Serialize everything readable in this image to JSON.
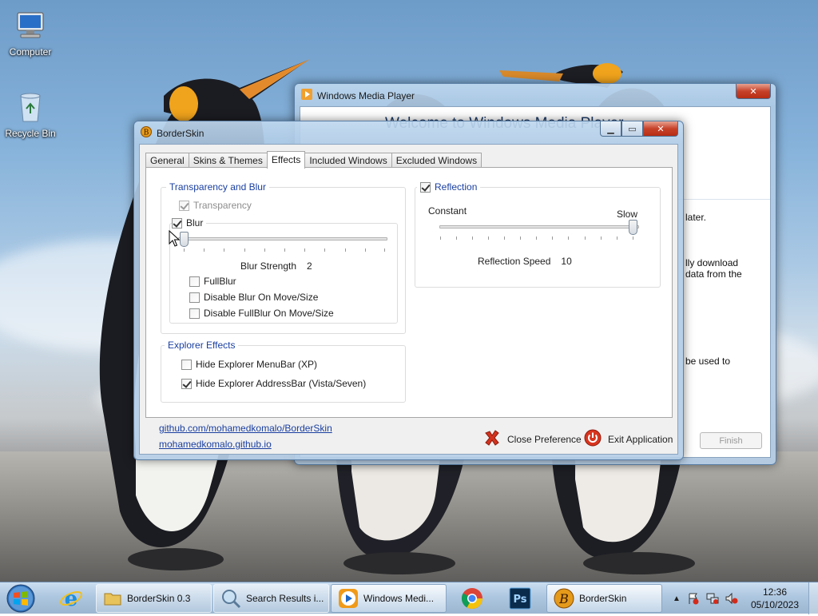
{
  "desktop": {
    "icons": [
      {
        "label": "Computer",
        "icon": "computer-icon"
      },
      {
        "label": "Recycle Bin",
        "icon": "recycle-bin-icon"
      }
    ]
  },
  "wmp": {
    "title": "Windows Media Player",
    "welcome": "Welcome to Windows Media Player",
    "fragment1": "later.",
    "fragment2a": "lly download",
    "fragment2b": "data from the",
    "fragment3": "be used to",
    "finish": "Finish"
  },
  "borderskin": {
    "title": "BorderSkin",
    "tabs": [
      "General",
      "Skins & Themes",
      "Effects",
      "Included Windows",
      "Excluded Windows"
    ],
    "active_tab": "Effects",
    "transparency_group": {
      "caption": "Transparency and Blur",
      "transparency": {
        "label": "Transparency",
        "checked": true,
        "enabled": false
      },
      "blur": {
        "label": "Blur",
        "checked": true
      },
      "blur_strength_label": "Blur Strength",
      "blur_strength_value": "2",
      "fullblur": {
        "label": "FullBlur",
        "checked": false
      },
      "disable_blur_move": {
        "label": "Disable Blur On Move/Size",
        "checked": false
      },
      "disable_fullblur_move": {
        "label": "Disable FullBlur On Move/Size",
        "checked": false
      }
    },
    "reflection_group": {
      "caption": "Reflection",
      "checked": true,
      "left_label": "Constant",
      "right_label": "Slow",
      "speed_label": "Reflection Speed",
      "speed_value": "10"
    },
    "explorer_group": {
      "caption": "Explorer Effects",
      "hide_menubar": {
        "label": "Hide Explorer MenuBar (XP)",
        "checked": false
      },
      "hide_addressbar": {
        "label": "Hide Explorer AddressBar (Vista/Seven)",
        "checked": true
      }
    },
    "links": [
      "github.com/mohamedkomalo/BorderSkin",
      "mohamedkomalo.github.io"
    ],
    "close_preference": "Close Preference",
    "exit_application": "Exit Application"
  },
  "taskbar": {
    "items": [
      {
        "label": "BorderSkin 0.3",
        "icon": "folder-icon"
      },
      {
        "label": "Search Results i...",
        "icon": "search-icon"
      },
      {
        "label": "Windows Medi...",
        "icon": "media-player-icon"
      },
      {
        "label": "BorderSkin",
        "icon": "borderskin-icon"
      }
    ],
    "pinned": [
      "internet-explorer-icon",
      "chrome-icon",
      "photoshop-icon"
    ],
    "clock_time": "12:36",
    "clock_date": "05/10/2023"
  },
  "colors": {
    "group_caption": "#1a3fa0",
    "close_red": "#c7422a",
    "link": "#1a3fa0"
  }
}
